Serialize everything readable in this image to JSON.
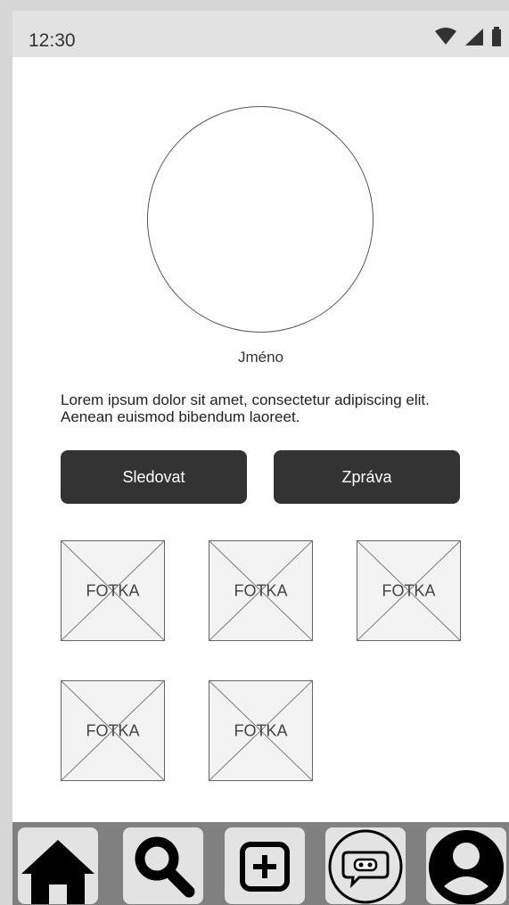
{
  "status_bar": {
    "time": "12:30",
    "icons": [
      "wifi-icon",
      "signal-icon",
      "battery-icon"
    ]
  },
  "profile": {
    "name": "Jméno",
    "bio": "Lorem ipsum dolor sit amet, consectetur adipiscing elit. Aenean euismod bibendum laoreet."
  },
  "actions": {
    "follow_label": "Sledovat",
    "message_label": "Zpráva"
  },
  "photos": [
    {
      "label": "FOTKA"
    },
    {
      "label": "FOTKA"
    },
    {
      "label": "FOTKA"
    },
    {
      "label": "FOTKA"
    },
    {
      "label": "FOTKA"
    }
  ],
  "bottom_nav": {
    "items": [
      "home-icon",
      "search-icon",
      "add-icon",
      "chat-icon",
      "profile-icon"
    ]
  },
  "colors": {
    "button_bg": "#333333",
    "nav_bg": "#808080",
    "status_bg": "#e2e2e2",
    "photo_bg": "#f3f3f3"
  }
}
